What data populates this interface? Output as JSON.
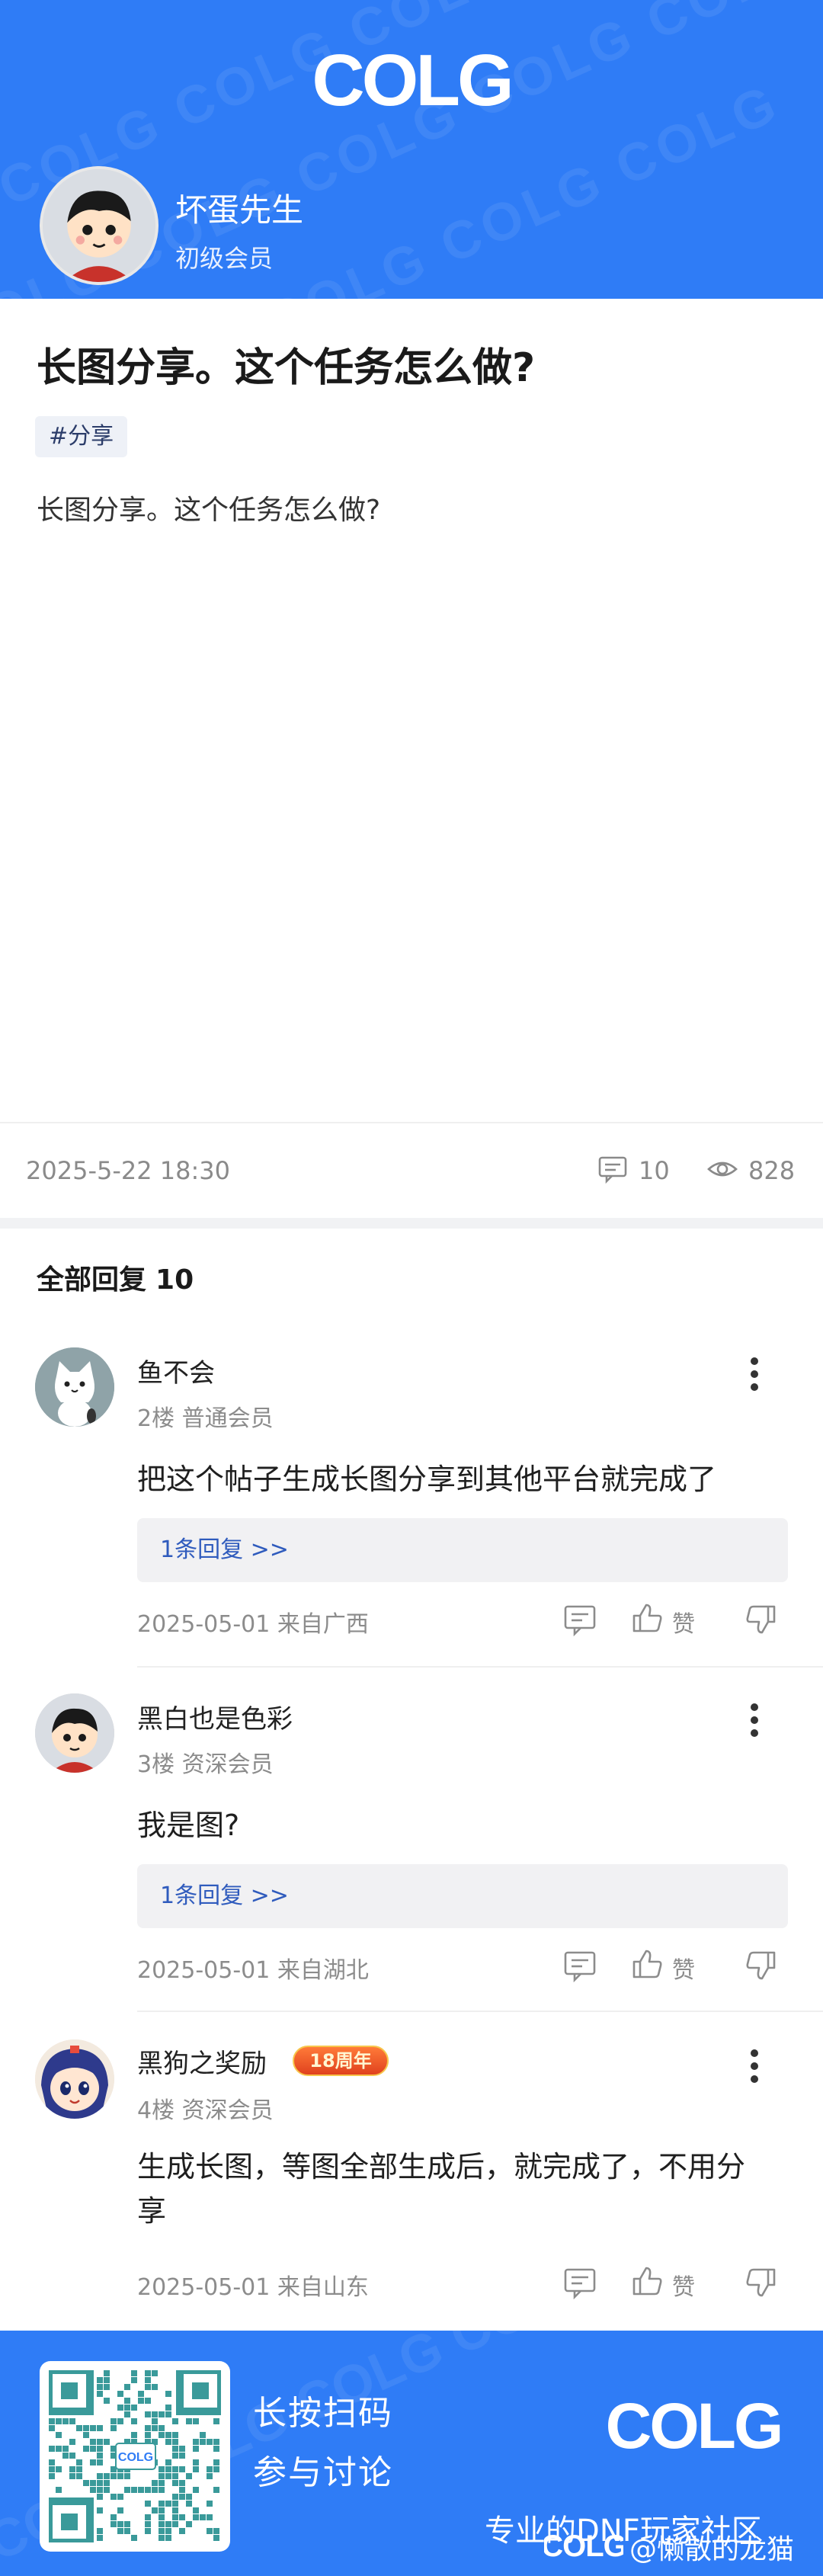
{
  "brand": {
    "logo_text": "COLG",
    "accent_color": "#2f7cf6"
  },
  "author": {
    "name": "坏蛋先生",
    "level": "初级会员"
  },
  "post": {
    "title": "长图分享。这个任务怎么做?",
    "tag": "#分享",
    "body": "长图分享。这个任务怎么做?",
    "date": "2025-5-22 18:30",
    "comment_count": "10",
    "view_count": "828"
  },
  "replies_header": {
    "label": "全部回复",
    "count": "10"
  },
  "replies": [
    {
      "name": "鱼不会",
      "floor": "2楼 普通会员",
      "text": "把这个帖子生成长图分享到其他平台就完成了",
      "sub_replies": "1条回复 >>",
      "date": "2025-05-01 来自广西",
      "like_label": "赞"
    },
    {
      "name": "黑白也是色彩",
      "floor": "3楼 资深会员",
      "text": "我是图?",
      "sub_replies": "1条回复 >>",
      "date": "2025-05-01 来自湖北",
      "like_label": "赞"
    },
    {
      "name": "黑狗之奖励",
      "badge": "18周年",
      "floor": "4楼 资深会员",
      "text": "生成长图，等图全部生成后，就完成了，不用分享",
      "date": "2025-05-01 来自山东",
      "like_label": "赞"
    }
  ],
  "footer": {
    "qr_center": "COLG",
    "line1": "长按扫码",
    "line2": "参与讨论",
    "logo_text": "COLG",
    "slogan": "专业的DNF玩家社区",
    "credit": "@懒散的龙猫"
  }
}
